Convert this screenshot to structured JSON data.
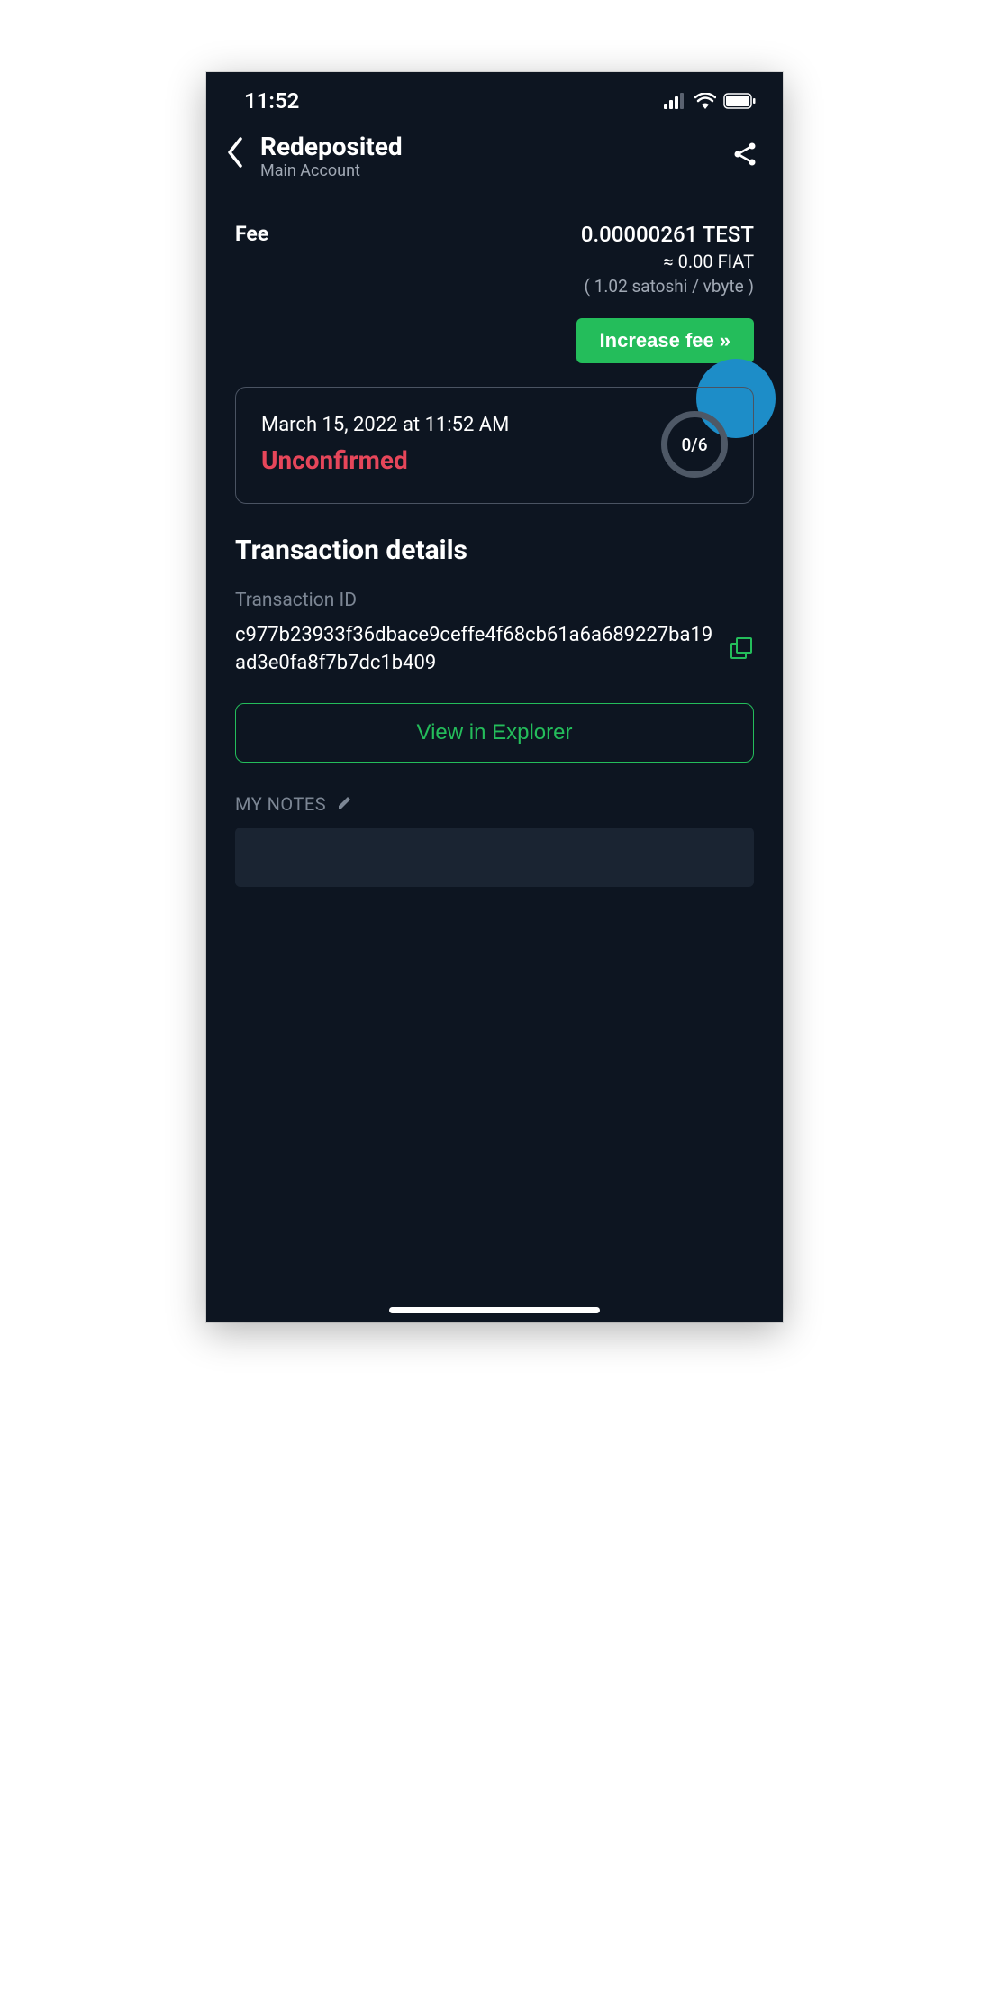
{
  "status_bar": {
    "time": "11:52"
  },
  "nav": {
    "title": "Redeposited",
    "subtitle": "Main Account"
  },
  "fee": {
    "label": "Fee",
    "amount": "0.00000261 TEST",
    "fiat": "≈ 0.00 FIAT",
    "rate": "( 1.02 satoshi / vbyte )",
    "increase_label": "Increase fee"
  },
  "status": {
    "date": "March 15, 2022 at 11:52 AM",
    "label": "Unconfirmed",
    "confirmations": "0/6"
  },
  "details": {
    "section_title": "Transaction details",
    "txid_label": "Transaction ID",
    "txid": "c977b23933f36dbace9ceffe4f68cb61a6a689227ba19ad3e0fa8f7b7dc1b409",
    "explorer_label": "View in Explorer"
  },
  "notes": {
    "label": "MY NOTES"
  }
}
